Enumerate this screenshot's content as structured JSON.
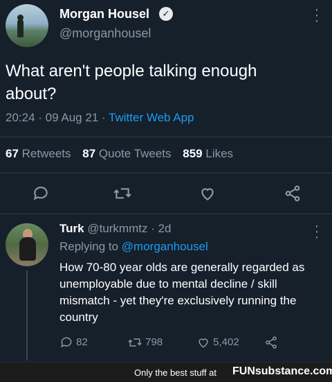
{
  "tweet": {
    "author_name": "Morgan Housel",
    "author_handle": "@morganhousel",
    "text": "What aren't people talking enough about?",
    "time": "20:24",
    "date": "09 Aug 21",
    "source": "Twitter Web App",
    "retweets_count": "67",
    "retweets_label": "Retweets",
    "quotes_count": "87",
    "quotes_label": "Quote Tweets",
    "likes_count": "859",
    "likes_label": "Likes"
  },
  "reply": {
    "author_name": "Turk",
    "author_handle": "@turkmmtz",
    "age": "2d",
    "replying_prefix": "Replying to",
    "replying_to": "@morganhousel",
    "text": "How 70-80 year olds are generally regarded as unemployable due to mental decline / skill mismatch - yet they're exclusively running the country",
    "reply_count": "82",
    "retweet_count": "798",
    "like_count": "5,402"
  },
  "footer": {
    "tagline": "Only the best stuff at",
    "brand": "FUNsubstance.com"
  },
  "colors": {
    "background": "#15202b",
    "accent": "#1d9bf0",
    "muted": "#8b98a5"
  },
  "icons": [
    "verified-badge-icon",
    "more-options-icon",
    "reply-icon",
    "retweet-icon",
    "like-icon",
    "share-icon"
  ]
}
